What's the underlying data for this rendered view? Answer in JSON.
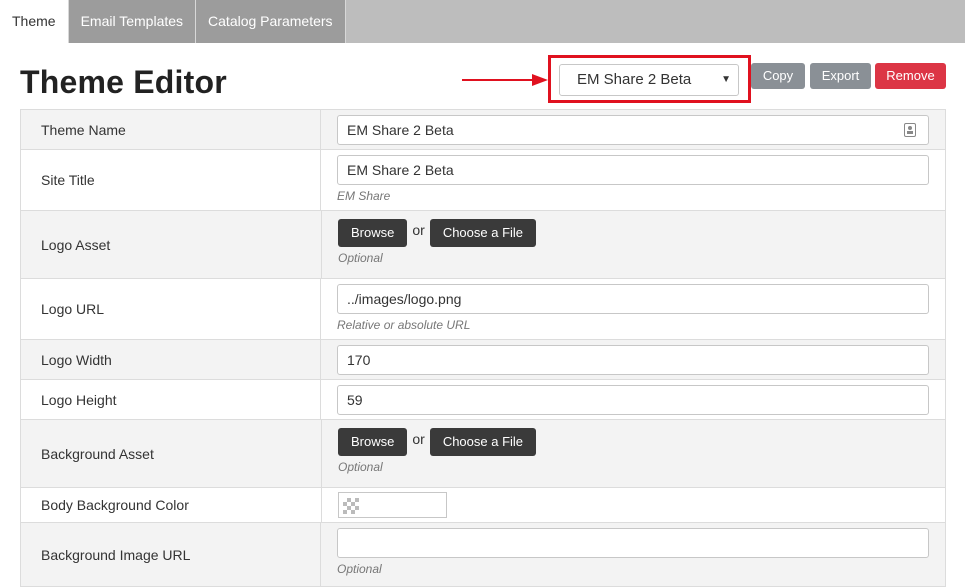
{
  "tabs": [
    {
      "label": "Theme",
      "active": true
    },
    {
      "label": "Email Templates",
      "active": false
    },
    {
      "label": "Catalog Parameters",
      "active": false
    }
  ],
  "page_title": "Theme Editor",
  "theme_select": {
    "selected": "EM Share 2 Beta",
    "icon": "caret-down-icon"
  },
  "actions": {
    "copy": "Copy",
    "export": "Export",
    "remove": "Remove"
  },
  "colors": {
    "highlight": "#e0111f",
    "remove": "#dc3545",
    "secondary": "#8a9096",
    "dark_button": "#3a3a3a"
  },
  "fields": {
    "theme_name": {
      "label": "Theme Name",
      "value": "EM Share 2 Beta"
    },
    "site_title": {
      "label": "Site Title",
      "value": "EM Share 2 Beta",
      "hint": "EM Share"
    },
    "logo_asset": {
      "label": "Logo Asset",
      "browse": "Browse",
      "or": "or",
      "choose": "Choose a File",
      "hint": "Optional"
    },
    "logo_url": {
      "label": "Logo URL",
      "value": "../images/logo.png",
      "hint": "Relative or absolute URL"
    },
    "logo_width": {
      "label": "Logo Width",
      "value": "170"
    },
    "logo_height": {
      "label": "Logo Height",
      "value": "59"
    },
    "background_asset": {
      "label": "Background Asset",
      "browse": "Browse",
      "or": "or",
      "choose": "Choose a File",
      "hint": "Optional"
    },
    "body_background_color": {
      "label": "Body Background Color",
      "value": ""
    },
    "background_image_url": {
      "label": "Background Image URL",
      "value": "",
      "hint": "Optional"
    }
  }
}
